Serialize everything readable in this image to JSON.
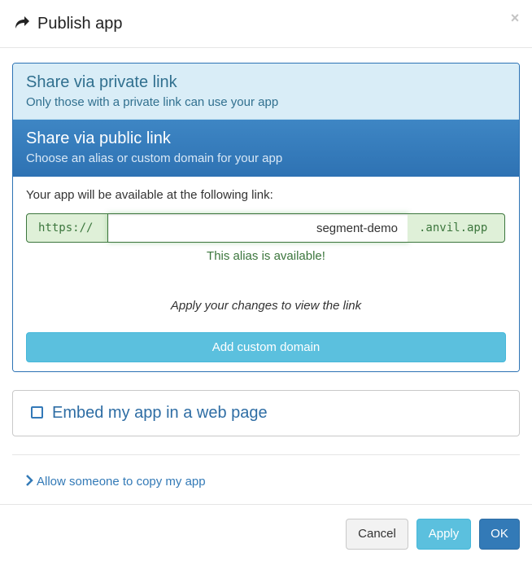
{
  "header": {
    "title": "Publish app",
    "close_label": "×",
    "icon": "share-icon"
  },
  "share": {
    "private": {
      "heading": "Share via private link",
      "subtitle": "Only those with a private link can use your app"
    },
    "public": {
      "heading": "Share via public link",
      "subtitle": "Choose an alias or custom domain for your app",
      "lead": "Your app will be available at the following link:",
      "prefix": "https://",
      "alias_value": "segment-demo",
      "suffix": ".anvil.app",
      "status": "This alias is available!",
      "apply_note": "Apply your changes to view the link",
      "custom_domain_label": "Add custom domain"
    }
  },
  "embed": {
    "label": "Embed my app in a web page",
    "checked": false
  },
  "copy": {
    "label": "Allow someone to copy my app",
    "icon": "chevron-right-icon"
  },
  "footer": {
    "cancel_label": "Cancel",
    "apply_label": "Apply",
    "ok_label": "OK"
  },
  "colors": {
    "primary": "#337ab7",
    "info": "#5bc0de",
    "success_text": "#3c763d",
    "success_bg": "#dff0d8",
    "private_bg": "#d9edf7"
  }
}
